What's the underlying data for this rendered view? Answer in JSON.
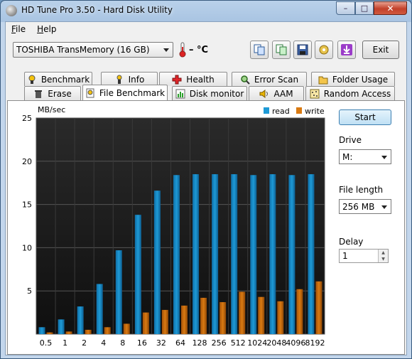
{
  "window": {
    "title": "HD Tune Pro 3.50 - Hard Disk Utility",
    "minimize": "–",
    "maximize": "□",
    "close": "✕"
  },
  "menu": [
    {
      "accel": "F",
      "rest": "ile"
    },
    {
      "accel": "H",
      "rest": "elp"
    }
  ],
  "toolbar": {
    "drive": "TOSHIBA TransMemory (16 GB)",
    "temperature": "– °C",
    "exit_label": "Exit",
    "icons": [
      "copy-info-icon",
      "copy-screen-icon",
      "save-icon",
      "options-icon",
      "download-icon"
    ]
  },
  "tabs_row1": [
    "Benchmark",
    "Info",
    "Health",
    "Error Scan",
    "Folder Usage"
  ],
  "tabs_row2": [
    "Erase",
    "File Benchmark",
    "Disk monitor",
    "AAM",
    "Random Access"
  ],
  "active_tab": "File Benchmark",
  "side": {
    "start_label": "Start",
    "drive_label": "Drive",
    "drive_value": "M:",
    "file_length_label": "File length",
    "file_length_value": "256 MB",
    "delay_label": "Delay",
    "delay_value": "1"
  },
  "colors": {
    "read": "#1e9ad6",
    "write": "#d97a12",
    "plot_bg": "#1a1a1a",
    "grid": "#555555"
  },
  "chart_data": {
    "type": "bar",
    "ylabel": "MB/sec",
    "ylim": [
      0,
      25
    ],
    "yticks": [
      5,
      10,
      15,
      20,
      25
    ],
    "categories": [
      "0.5",
      "1",
      "2",
      "4",
      "8",
      "16",
      "32",
      "64",
      "128",
      "256",
      "512",
      "1024",
      "2048",
      "4096",
      "8192"
    ],
    "series": [
      {
        "name": "read",
        "values": [
          0.8,
          1.7,
          3.2,
          5.8,
          9.7,
          13.8,
          16.6,
          18.4,
          18.5,
          18.5,
          18.5,
          18.4,
          18.5,
          18.4,
          18.5
        ]
      },
      {
        "name": "write",
        "values": [
          0.2,
          0.3,
          0.5,
          0.8,
          1.2,
          2.5,
          2.8,
          3.3,
          4.2,
          3.7,
          4.9,
          4.3,
          3.8,
          5.2,
          6.1
        ]
      }
    ],
    "legend": "top-right"
  }
}
